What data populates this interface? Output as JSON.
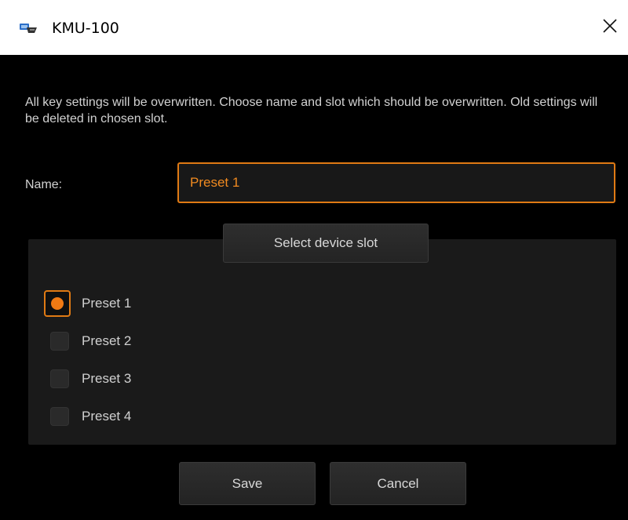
{
  "window": {
    "title": "KMU-100",
    "app_icon": "device-icon",
    "close_icon": "close-icon"
  },
  "dialog": {
    "description": "All key settings will be overwritten. Choose name and slot which should be overwritten. Old settings will be deleted in chosen slot.",
    "name_label": "Name:",
    "name_value": "Preset 1",
    "slot_group_title": "Select device slot",
    "slots": [
      {
        "label": "Preset 1",
        "selected": true
      },
      {
        "label": "Preset 2",
        "selected": false
      },
      {
        "label": "Preset 3",
        "selected": false
      },
      {
        "label": "Preset 4",
        "selected": false
      }
    ],
    "save_label": "Save",
    "cancel_label": "Cancel"
  },
  "colors": {
    "accent": "#e07a14",
    "background": "#000000",
    "panel": "#1a1a1a",
    "text": "#d2d2d2"
  }
}
